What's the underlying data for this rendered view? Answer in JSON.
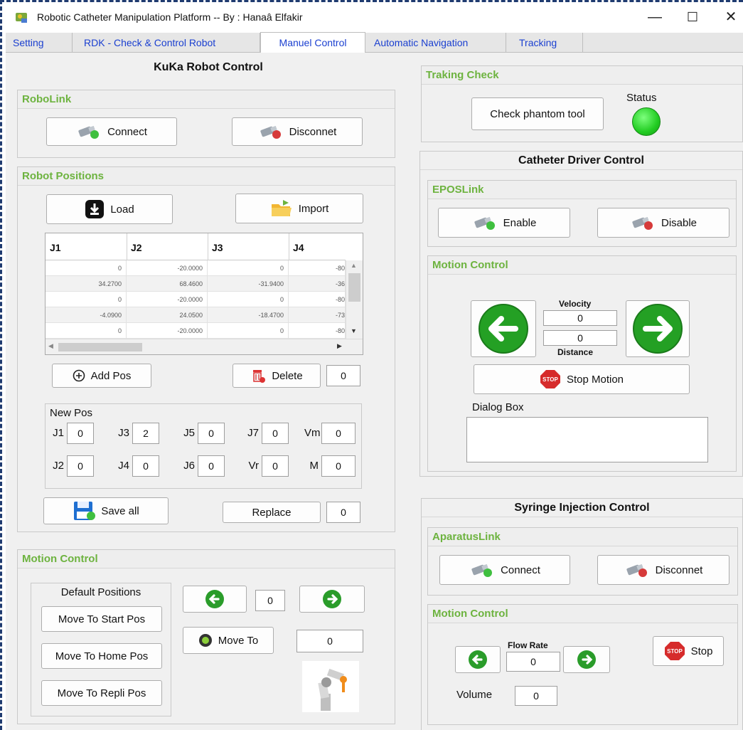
{
  "window": {
    "title": "Robotic Catheter Manipulation Platform -- By : Hanaâ Elfakir",
    "minimize": "—",
    "maximize": "☐",
    "close": "✕"
  },
  "tabs": [
    "Setting",
    "RDK - Check & Control Robot",
    "Manuel Control",
    "Automatic Navigation",
    "Tracking"
  ],
  "active_tab": "Manuel Control",
  "kuka": {
    "title": "KuKa Robot Control",
    "robolink": {
      "title": "RoboLink",
      "connect": "Connect",
      "disconnect": "Disconnet"
    },
    "positions": {
      "title": "Robot Positions",
      "load": "Load",
      "import": "Import",
      "columns": [
        "J1",
        "J2",
        "J3",
        "J4"
      ],
      "rows": [
        [
          "0",
          "-20.0000",
          "0",
          "-80"
        ],
        [
          "34.2700",
          "68.4600",
          "-31.9400",
          "-36"
        ],
        [
          "0",
          "-20.0000",
          "0",
          "-80"
        ],
        [
          "-4.0900",
          "24.0500",
          "-18.4700",
          "-73"
        ],
        [
          "0",
          "-20.0000",
          "0",
          "-80"
        ]
      ],
      "add_pos": "Add Pos",
      "delete": "Delete",
      "delete_index": "0",
      "newpos": {
        "title": "New Pos",
        "fields": [
          {
            "label": "J1",
            "value": "0"
          },
          {
            "label": "J3",
            "value": "2"
          },
          {
            "label": "J5",
            "value": "0"
          },
          {
            "label": "J7",
            "value": "0"
          },
          {
            "label": "Vm",
            "value": "0"
          },
          {
            "label": "J2",
            "value": "0"
          },
          {
            "label": "J4",
            "value": "0"
          },
          {
            "label": "J6",
            "value": "0"
          },
          {
            "label": "Vr",
            "value": "0"
          },
          {
            "label": "M",
            "value": "0"
          }
        ]
      },
      "save_all": "Save all",
      "replace": "Replace",
      "replace_index": "0"
    },
    "motion": {
      "title": "Motion Control",
      "default_positions": "Default Positions",
      "start": "Move To Start Pos",
      "home": "Move To Home Pos",
      "repli": "Move To Repli Pos",
      "step_value": "0",
      "move_to": "Move To",
      "move_to_value": "0"
    }
  },
  "tracking": {
    "title": "Traking Check",
    "check": "Check phantom tool",
    "status": "Status",
    "status_color": "#22cc22"
  },
  "catheter": {
    "title": "Catheter Driver Control",
    "epos": {
      "title": "EPOSLink",
      "enable": "Enable",
      "disable": "Disable"
    },
    "motion": {
      "title": "Motion Control",
      "velocity_label": "Velocity",
      "velocity": "0",
      "distance": "0",
      "distance_label": "Distance",
      "stop": "Stop Motion",
      "dialog": "Dialog Box"
    }
  },
  "syringe": {
    "title": "Syringe Injection Control",
    "link": {
      "title": "AparatusLink",
      "connect": "Connect",
      "disconnect": "Disconnet"
    },
    "motion": {
      "title": "Motion Control",
      "flow_label": "Flow Rate",
      "flow": "0",
      "stop": "Stop",
      "volume_label": "Volume",
      "volume": "0"
    }
  },
  "icons": {
    "stop_text": "STOP"
  },
  "colors": {
    "accent_green": "#6db33f",
    "tab_blue": "#1a3fd0"
  }
}
